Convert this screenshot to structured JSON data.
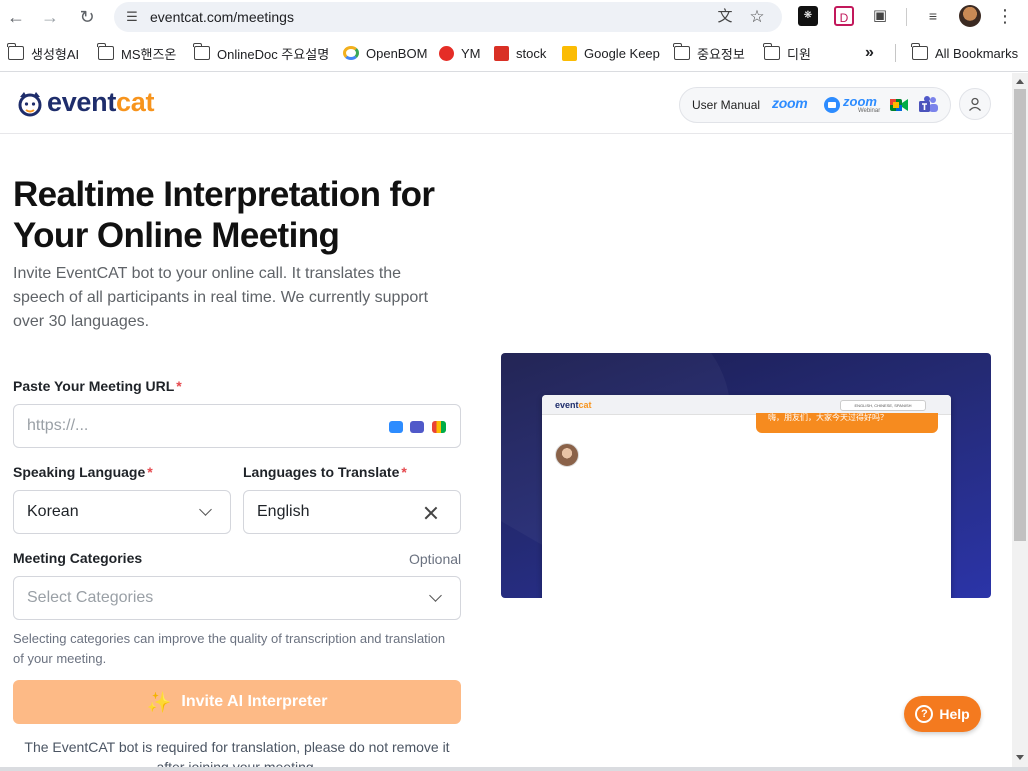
{
  "browser": {
    "url": "eventcat.com/meetings",
    "bookmarks": [
      {
        "label": "생성형AI",
        "icon": "folder-icon"
      },
      {
        "label": "MS핸즈온",
        "icon": "folder-icon"
      },
      {
        "label": "OnlineDoc 주요설명",
        "icon": "folder-icon"
      },
      {
        "label": "OpenBOM",
        "icon": "openbom-icon"
      },
      {
        "label": "YM",
        "icon": "youtube-music-icon"
      },
      {
        "label": "stock",
        "icon": "stock-icon"
      },
      {
        "label": "Google Keep",
        "icon": "google-keep-icon"
      },
      {
        "label": "중요정보",
        "icon": "folder-icon"
      },
      {
        "label": "디원",
        "icon": "folder-icon"
      }
    ],
    "overflow_label": "»",
    "all_bookmarks_label": "All Bookmarks"
  },
  "header": {
    "logo_part1": "event",
    "logo_part2": "cat",
    "user_manual_label": "User Manual",
    "zoom_label": "zoom",
    "zoom_webinar_label": "zoom",
    "zoom_webinar_sub": "Webinar"
  },
  "hero": {
    "title": "Realtime Interpretation for Your Online Meeting",
    "subtitle": "Invite EventCAT bot to your online call. It translates the speech of all participants in real time. We currently support over 30 languages."
  },
  "form": {
    "meeting_url_label": "Paste Your Meeting URL",
    "required_mark": "*",
    "meeting_url_placeholder": "https://...",
    "speaking_language_label": "Speaking Language",
    "speaking_language_value": "Korean",
    "translate_label": "Languages to Translate",
    "translate_value": "English",
    "categories_label": "Meeting Categories",
    "optional_label": "Optional",
    "categories_placeholder": "Select Categories",
    "categories_hint": "Selecting categories can improve the quality of transcription and translation of your meeting.",
    "invite_button": "Invite AI Interpreter",
    "footnote": "The EventCAT bot is required for translation, please do not remove it after joining your meeting."
  },
  "preview": {
    "logo_part1": "event",
    "logo_part2": "cat",
    "language_chip": "ENGLISH, CHINESE, SPANISH",
    "bubble_text": "嗨，朋友们，大家今天过得好吗？"
  },
  "help": {
    "label": "Help"
  },
  "colors": {
    "brand_navy": "#1e2d6b",
    "brand_orange": "#f7941d",
    "invite_button_disabled": "#fdba86",
    "help_button": "#f47a1f",
    "required": "#e5484d"
  }
}
